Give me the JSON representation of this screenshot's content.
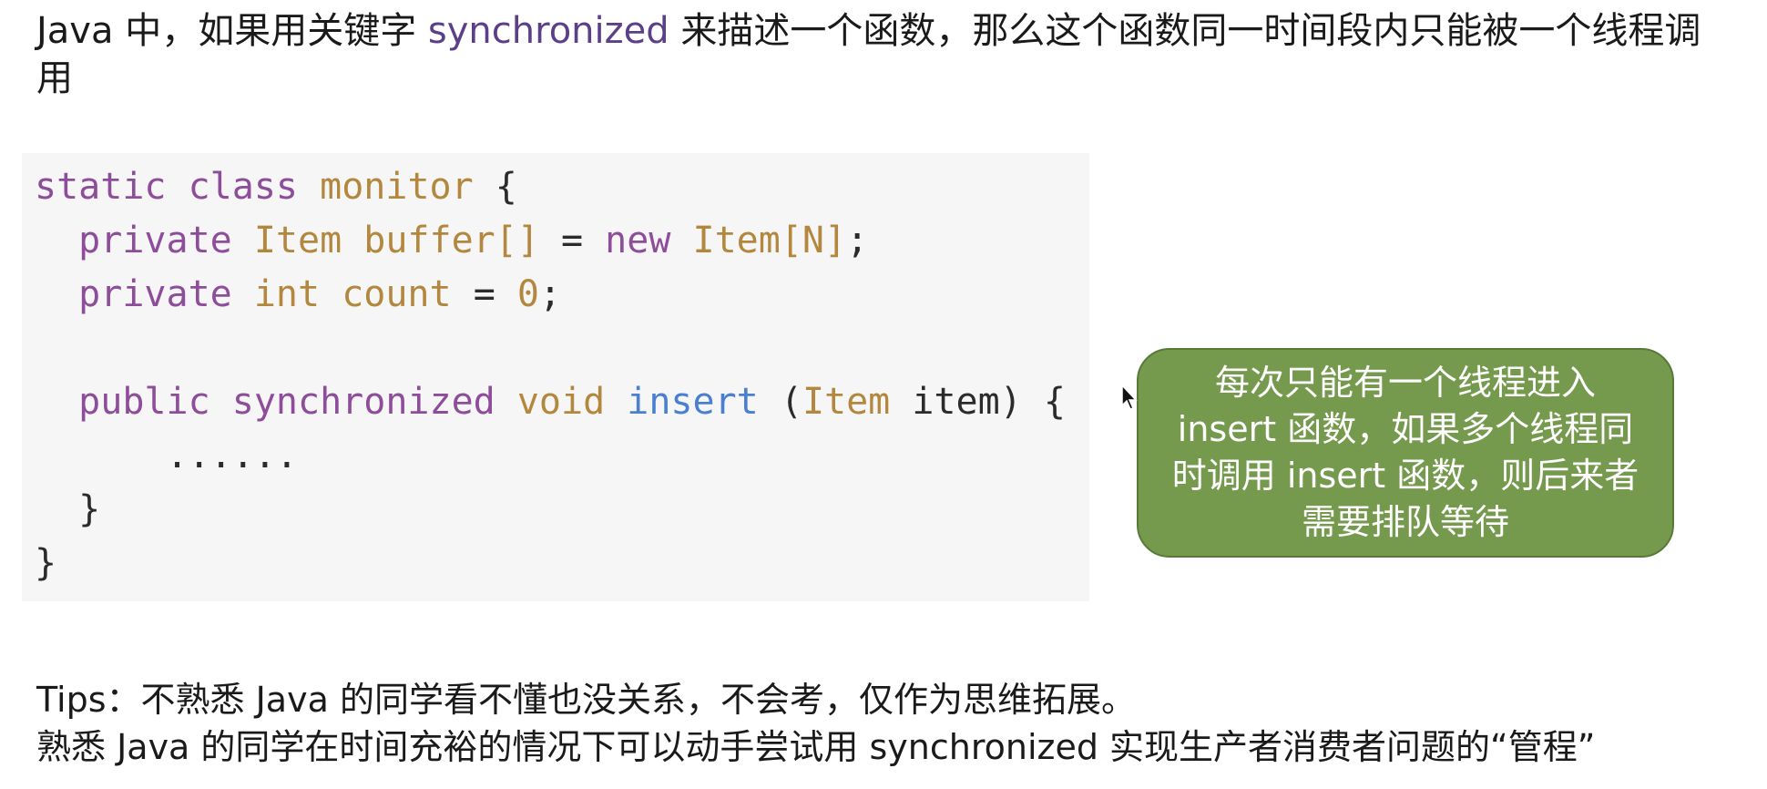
{
  "intro": {
    "part1": "Java 中，如果用关键字 ",
    "keyword": "synchronized",
    "part2": " 来描述一个函数，那么这个函数同一时间段内只能被一个线程调用"
  },
  "code": {
    "line1": {
      "kw1": "static",
      "kw2": "class",
      "name": "monitor",
      "tail": " {"
    },
    "line2": {
      "indent": "  ",
      "kw": "private",
      "type": "Item",
      "name": "buffer[]",
      "eq": " = ",
      "kw_new": "new",
      "expr": "Item[N]",
      "tail": ";"
    },
    "line3": {
      "indent": "  ",
      "kw": "private",
      "type": "int",
      "name": "count",
      "eq": " = ",
      "num": "0",
      "tail": ";"
    },
    "line5": {
      "indent": "  ",
      "kw1": "public",
      "kw2": "synchronized",
      "type": "void",
      "fn": "insert",
      "open": " (",
      "ptype": "Item",
      "pname": " item",
      "close": ") {"
    },
    "line6": "      ......",
    "line7": "  }",
    "line8": "}"
  },
  "callout": {
    "text": "每次只能有一个线程进入 insert 函数，如果多个线程同时调用 insert 函数，则后来者需要排队等待"
  },
  "tips": {
    "line1": "Tips：不熟悉 Java 的同学看不懂也没关系，不会考，仅作为思维拓展。",
    "line2": "熟悉 Java 的同学在时间充裕的情况下可以动手尝试用 synchronized 实现生产者消费者问题的“管程”"
  },
  "colors": {
    "keyword": "#8e4d9a",
    "type": "#b3883e",
    "function": "#4a7fd1",
    "callout_bg": "#759a4e",
    "code_bg": "#f6f6f6"
  }
}
